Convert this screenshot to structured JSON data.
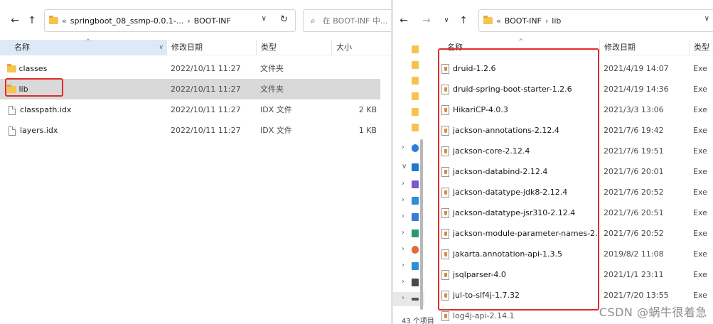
{
  "left": {
    "address": {
      "chevrons": "«",
      "segments": [
        "springboot_08_ssmp-0.0.1-...",
        "BOOT-INF"
      ],
      "dropdown": "∨",
      "refresh": "↻"
    },
    "search": {
      "placeholder": "在 BOOT-INF 中..."
    },
    "columns": [
      "名称",
      "修改日期",
      "类型",
      "大小"
    ],
    "rows": [
      {
        "name": "classes",
        "date": "2022/10/11 11:27",
        "type": "文件夹",
        "size": "",
        "icon": "folder-icon"
      },
      {
        "name": "lib",
        "date": "2022/10/11 11:27",
        "type": "文件夹",
        "size": "",
        "icon": "folder-icon"
      },
      {
        "name": "classpath.idx",
        "date": "2022/10/11 11:27",
        "type": "IDX 文件",
        "size": "2 KB",
        "icon": "file-icon"
      },
      {
        "name": "layers.idx",
        "date": "2022/10/11 11:27",
        "type": "IDX 文件",
        "size": "1 KB",
        "icon": "file-icon"
      }
    ]
  },
  "right": {
    "address": {
      "chevrons": "«",
      "segments": [
        "BOOT-INF",
        "lib"
      ],
      "dropdown": "∨"
    },
    "columns": [
      "名称",
      "修改日期",
      "类型"
    ],
    "rows": [
      {
        "name": "druid-1.2.6",
        "date": "2021/4/19 14:07",
        "type": "Exe"
      },
      {
        "name": "druid-spring-boot-starter-1.2.6",
        "date": "2021/4/19 14:36",
        "type": "Exe"
      },
      {
        "name": "HikariCP-4.0.3",
        "date": "2021/3/3 13:06",
        "type": "Exe"
      },
      {
        "name": "jackson-annotations-2.12.4",
        "date": "2021/7/6 19:42",
        "type": "Exe"
      },
      {
        "name": "jackson-core-2.12.4",
        "date": "2021/7/6 19:51",
        "type": "Exe"
      },
      {
        "name": "jackson-databind-2.12.4",
        "date": "2021/7/6 20:01",
        "type": "Exe"
      },
      {
        "name": "jackson-datatype-jdk8-2.12.4",
        "date": "2021/7/6 20:52",
        "type": "Exe"
      },
      {
        "name": "jackson-datatype-jsr310-2.12.4",
        "date": "2021/7/6 20:51",
        "type": "Exe"
      },
      {
        "name": "jackson-module-parameter-names-2....",
        "date": "2021/7/6 20:52",
        "type": "Exe"
      },
      {
        "name": "jakarta.annotation-api-1.3.5",
        "date": "2019/8/2 11:08",
        "type": "Exe"
      },
      {
        "name": "jsqlparser-4.0",
        "date": "2021/1/1 23:11",
        "type": "Exe"
      },
      {
        "name": "jul-to-slf4j-1.7.32",
        "date": "2021/7/20 13:55",
        "type": "Exe"
      },
      {
        "name": "log4j-api-2.14.1",
        "date": "",
        "type": ""
      }
    ],
    "status": "43 个项目"
  },
  "watermark": "CSDN @蜗牛很着急",
  "colors": {
    "highlight": "#e02b2b",
    "selected": "#d9d9d9",
    "folder": "#f4c44e",
    "header_sorted": "#dde9f7"
  }
}
